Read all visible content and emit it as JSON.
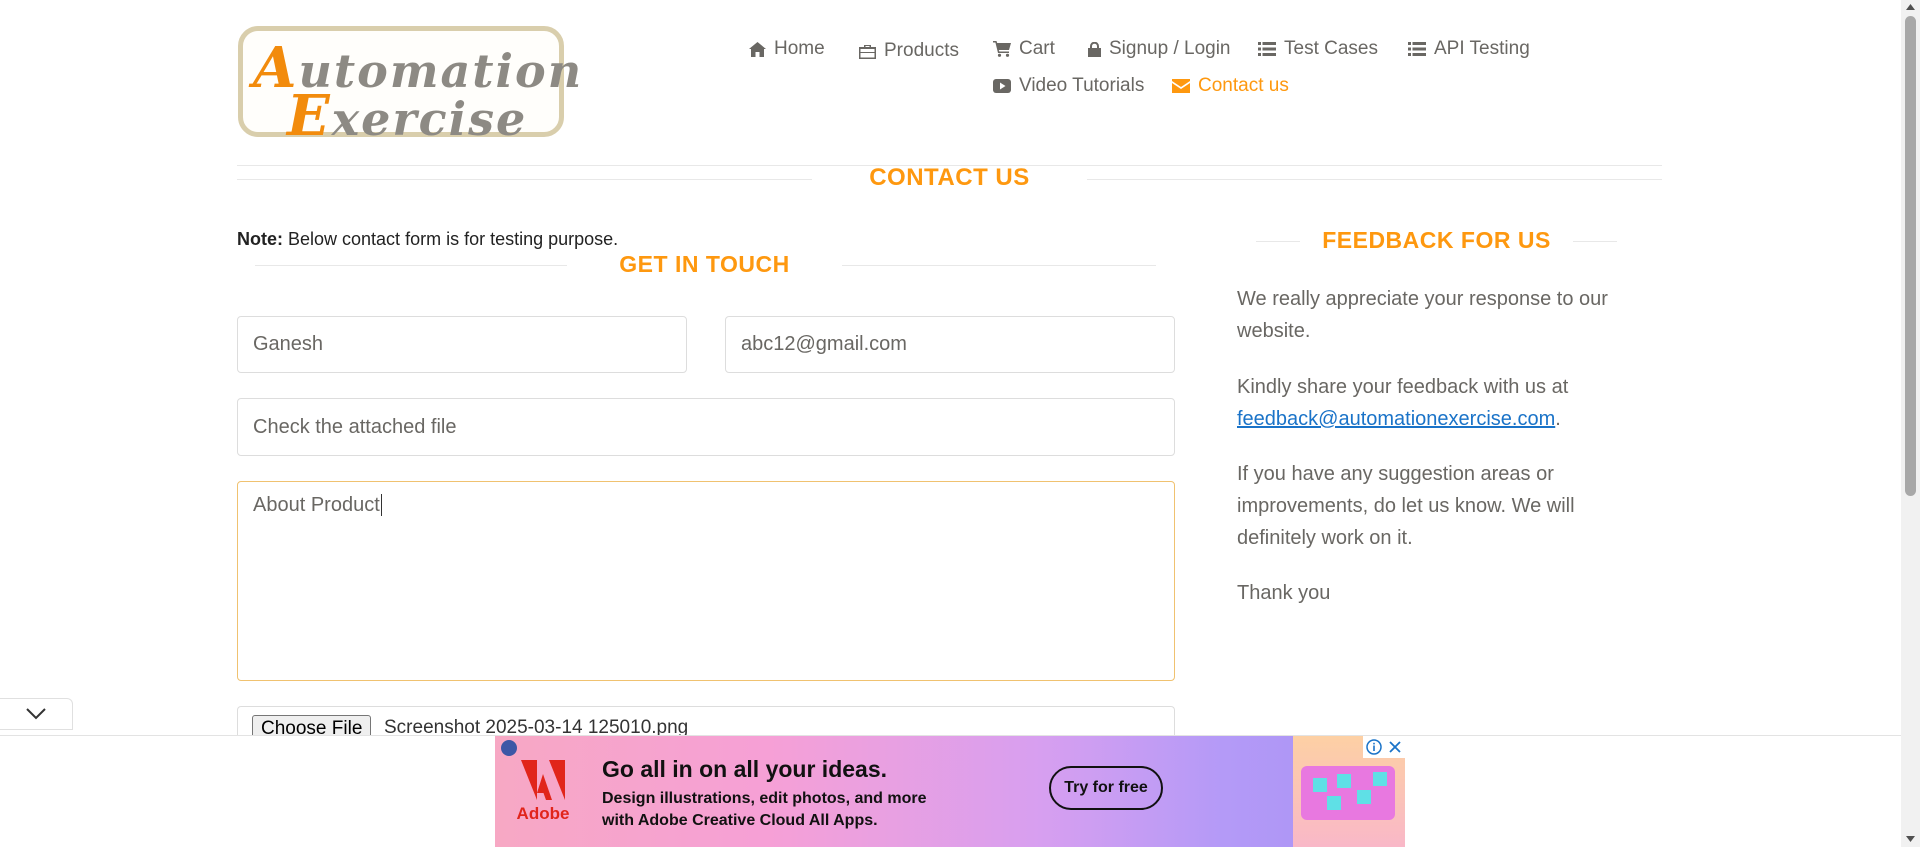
{
  "logo": {
    "line1_first": "A",
    "line1_rest": "utomation",
    "line2_first": "E",
    "line2_rest": "xercise"
  },
  "nav": {
    "home": "Home",
    "products": "Products",
    "cart": "Cart",
    "signup": "Signup / Login",
    "test_cases": "Test Cases",
    "api_testing": "API Testing",
    "video": "Video Tutorials",
    "contact": "Contact us"
  },
  "page_title": "CONTACT US",
  "note": {
    "label": "Note:",
    "text": " Below contact form is for testing purpose."
  },
  "form": {
    "heading": "GET IN TOUCH",
    "name": "Ganesh",
    "email": "abc12@gmail.com",
    "subject": "Check the attached file",
    "message": "About Product",
    "file_button": "Choose File",
    "file_name": "Screenshot 2025-03-14 125010.png"
  },
  "feedback": {
    "heading": "FEEDBACK FOR US",
    "p1": "We really appreciate your response to our website.",
    "p2_pre": "Kindly share your feedback with us at ",
    "p2_link": "feedback@automationexercise.com",
    "p2_post": ".",
    "p3": "If you have any suggestion areas or improvements, do let us know. We will definitely work on it.",
    "p4": "Thank you"
  },
  "ad": {
    "brand": "Adobe",
    "headline": "Go all in on all your ideas.",
    "body": "Design illustrations, edit photos, and more with Adobe Creative Cloud All Apps.",
    "cta": "Try for free"
  },
  "colors": {
    "accent": "#fe980f",
    "link": "#1a73c8",
    "text": "#696763"
  }
}
